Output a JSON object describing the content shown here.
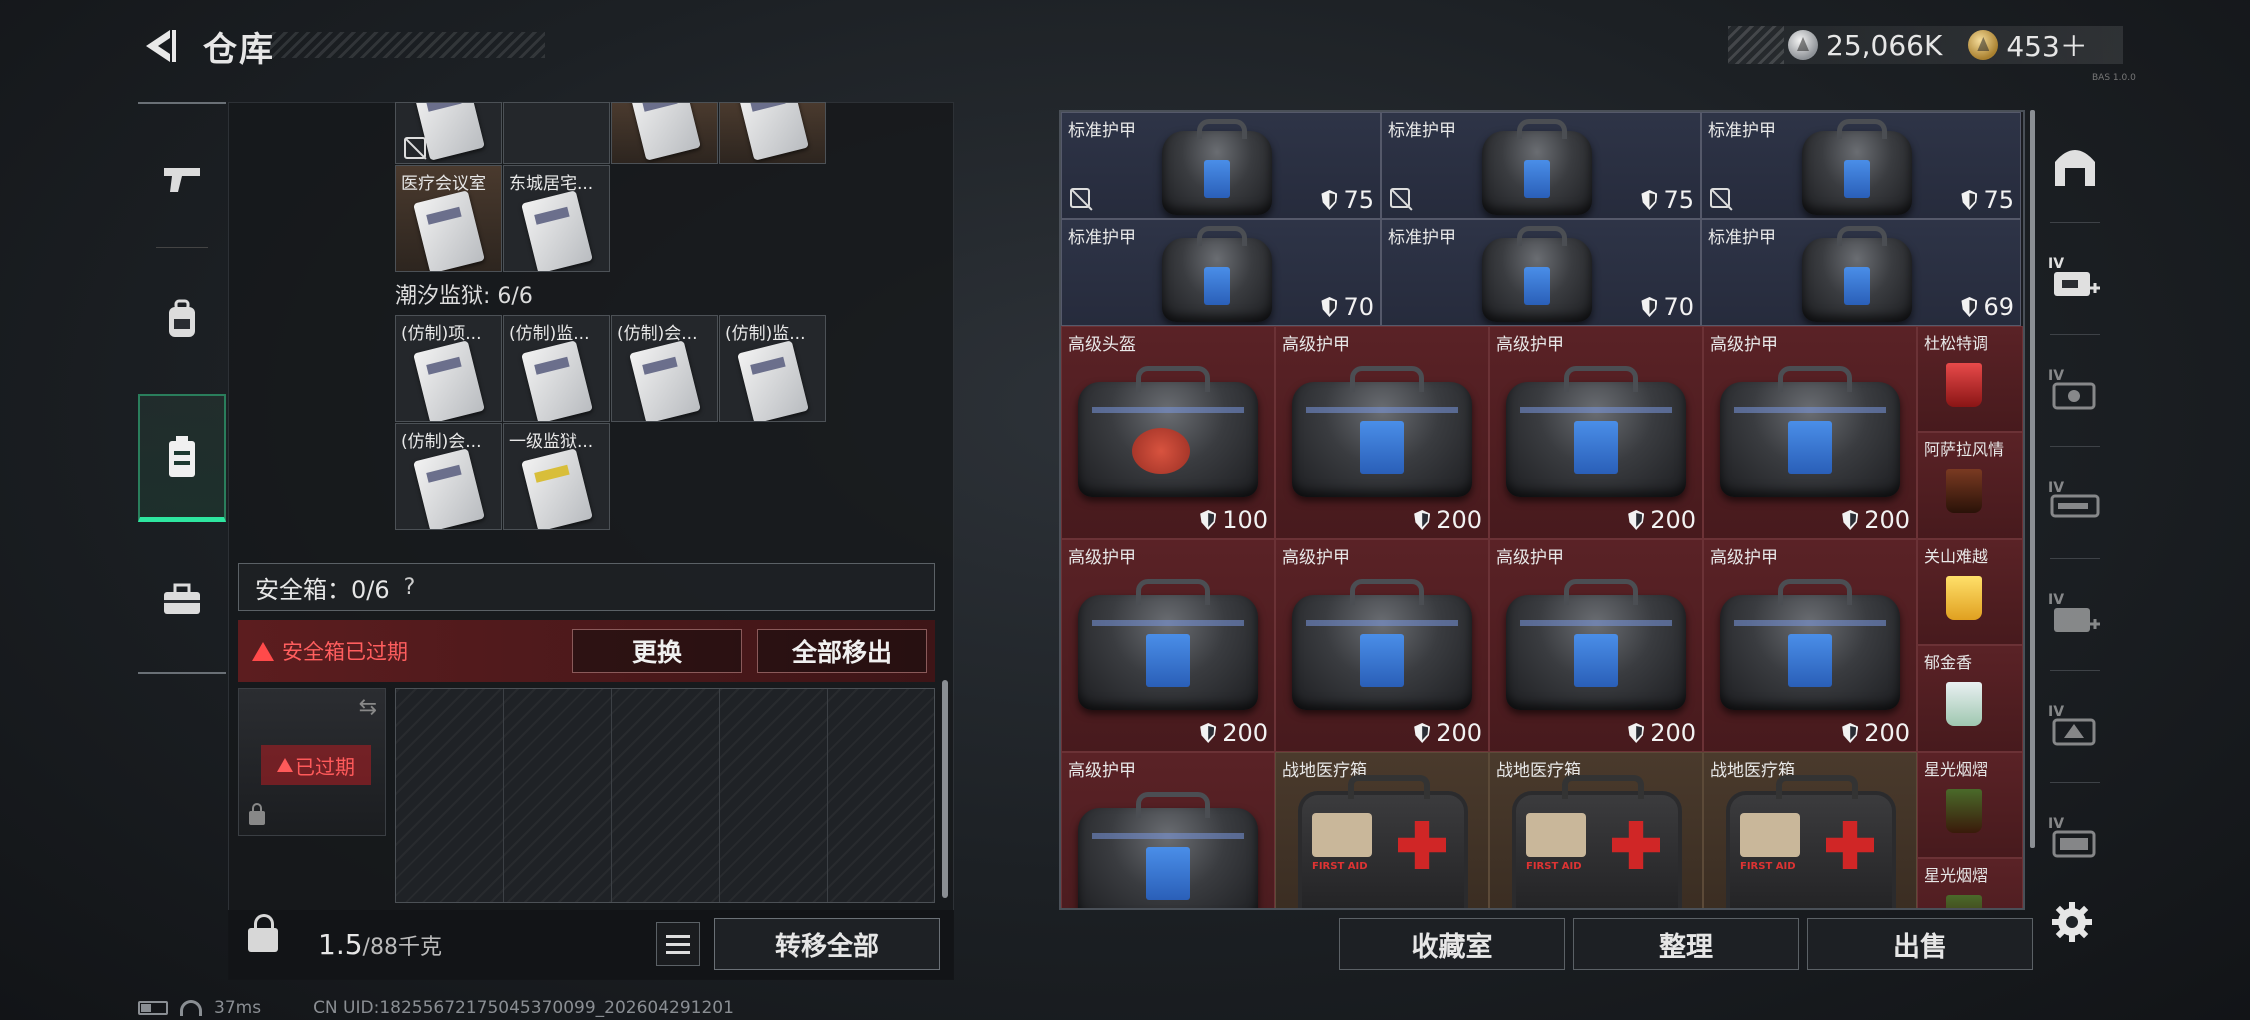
{
  "header": {
    "title": "仓库",
    "currency": {
      "coins": "25,066K",
      "premium": "453＋"
    },
    "version": "BAS 1.0.0"
  },
  "left_nav": [
    {
      "icon": "pistol-icon"
    },
    {
      "icon": "backpack-icon"
    },
    {
      "icon": "container-icon",
      "active": true
    },
    {
      "icon": "toolbox-icon"
    }
  ],
  "keycards": {
    "top_labels": [
      "医疗会议室",
      "东城居宅..."
    ],
    "section_title": "潮汐监狱: 6/6",
    "prison_labels": [
      "(仿制)项...",
      "(仿制)监...",
      "(仿制)会...",
      "(仿制)监...",
      "(仿制)会...",
      "一级监狱..."
    ]
  },
  "safebox": {
    "title": "安全箱：0/6",
    "help": "?",
    "expired_msg": "安全箱已过期",
    "replace_btn": "更换",
    "move_all_btn": "全部移出",
    "expired_badge": "已过期"
  },
  "bottom_left": {
    "weight_value": "1.5",
    "weight_unit": "/88千克",
    "transfer_btn": "转移全部"
  },
  "inventory": {
    "row1": [
      {
        "name": "标准护甲",
        "durability": "75"
      },
      {
        "name": "标准护甲",
        "durability": "75"
      },
      {
        "name": "标准护甲",
        "durability": "75"
      }
    ],
    "row2": [
      {
        "name": "标准护甲",
        "durability": "70"
      },
      {
        "name": "标准护甲",
        "durability": "70"
      },
      {
        "name": "标准护甲",
        "durability": "69"
      }
    ],
    "row3": [
      {
        "name": "高级头盔",
        "durability": "100"
      },
      {
        "name": "高级护甲",
        "durability": "200"
      },
      {
        "name": "高级护甲",
        "durability": "200"
      },
      {
        "name": "高级护甲",
        "durability": "200"
      }
    ],
    "row4": [
      {
        "name": "高级护甲",
        "durability": "200"
      },
      {
        "name": "高级护甲",
        "durability": "200"
      },
      {
        "name": "高级护甲",
        "durability": "200"
      },
      {
        "name": "高级护甲",
        "durability": "200"
      }
    ],
    "row5": [
      {
        "name": "高级护甲"
      },
      {
        "name": "战地医疗箱"
      },
      {
        "name": "战地医疗箱"
      },
      {
        "name": "战地医疗箱"
      }
    ],
    "side_items": [
      "杜松特调",
      "阿萨拉风情",
      "关山难越",
      "郁金香",
      "星光烟熠",
      "星光烟熠"
    ],
    "medkit_text": "FIRST AID"
  },
  "right_bar": {
    "collection_btn": "收藏室",
    "sort_btn": "整理",
    "sell_btn": "出售"
  },
  "status": {
    "ping": "37ms",
    "uid": "CN UID:182556721750453700​99_202604291201"
  },
  "colors": {
    "accent_green": "#2ee6a0",
    "expired_red": "#ff4a4a",
    "armor_blue": "#4a8ee8"
  }
}
